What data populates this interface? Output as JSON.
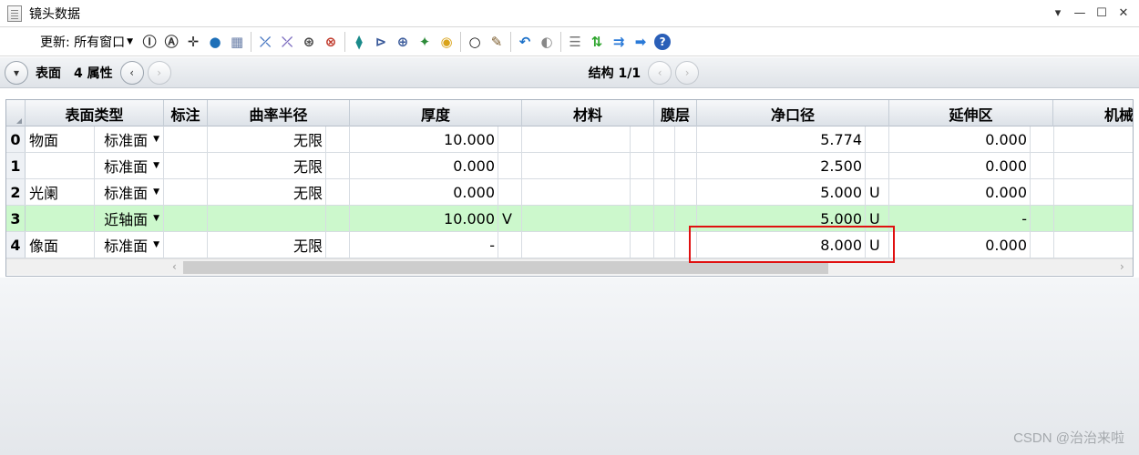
{
  "window": {
    "title": "镜头数据",
    "controls": [
      "▾",
      "—",
      "☐",
      "✕"
    ]
  },
  "toolbar": {
    "update_label": "更新: 所有窗口",
    "icons": [
      {
        "name": "refresh-icon",
        "glyph": "Ⓘ",
        "color": "#333"
      },
      {
        "name": "auto-update-icon",
        "glyph": "Ⓐ",
        "color": "#333"
      },
      {
        "name": "crosshair-icon",
        "glyph": "✛",
        "color": "#222"
      },
      {
        "name": "globe-icon",
        "glyph": "●",
        "color": "#1d6fb8"
      },
      {
        "name": "image-icon",
        "glyph": "▦",
        "color": "#6a7fa8"
      },
      {
        "name": "sep",
        "glyph": "",
        "color": ""
      },
      {
        "name": "insert-surface-icon",
        "glyph": "⤫",
        "color": "#4a78c2"
      },
      {
        "name": "delete-surface-icon",
        "glyph": "⤫",
        "color": "#7b6bbf"
      },
      {
        "name": "ray-trace-icon",
        "glyph": "⊛",
        "color": "#444"
      },
      {
        "name": "no-ray-icon",
        "glyph": "⊗",
        "color": "#c0392b"
      },
      {
        "name": "sep",
        "glyph": "",
        "color": ""
      },
      {
        "name": "lens-element-icon",
        "glyph": "⧫",
        "color": "#1a8a8a"
      },
      {
        "name": "lens-flip-icon",
        "glyph": "⊳",
        "color": "#3a5a9a"
      },
      {
        "name": "lens-split-icon",
        "glyph": "⊕",
        "color": "#3a5a9a"
      },
      {
        "name": "coordinate-icon",
        "glyph": "✦",
        "color": "#2e8b3a"
      },
      {
        "name": "palette-icon",
        "glyph": "◉",
        "color": "#d9a31a"
      },
      {
        "name": "sep",
        "glyph": "",
        "color": ""
      },
      {
        "name": "ring-icon",
        "glyph": "○",
        "color": "#111"
      },
      {
        "name": "pen-icon",
        "glyph": "✎",
        "color": "#7a5a2a"
      },
      {
        "name": "sep",
        "glyph": "",
        "color": ""
      },
      {
        "name": "undo-icon",
        "glyph": "↶",
        "color": "#1a6fc8"
      },
      {
        "name": "toggle-icon",
        "glyph": "◐",
        "color": "#888"
      },
      {
        "name": "sep",
        "glyph": "",
        "color": ""
      },
      {
        "name": "list-icon",
        "glyph": "☰",
        "color": "#777"
      },
      {
        "name": "swap-icon",
        "glyph": "⇅",
        "color": "#2aa32a"
      },
      {
        "name": "arrows-right-icon",
        "glyph": "⇉",
        "color": "#2a7ad8"
      },
      {
        "name": "arrow-right-icon",
        "glyph": "➡",
        "color": "#2a7ad8"
      },
      {
        "name": "help-icon",
        "glyph": "?",
        "color": "#ffffff"
      }
    ]
  },
  "nav": {
    "surface_label": "表面",
    "properties_label": "4 属性",
    "structure_label": "结构 1/1"
  },
  "columns": [
    "表面类型",
    "标注",
    "曲率半径",
    "厚度",
    "材料",
    "膜层",
    "净口径",
    "延伸区",
    "机械"
  ],
  "rows": [
    {
      "num": "0",
      "name": "物面",
      "type": "标准面",
      "radius": "无限",
      "thickness": "10.000",
      "thick_solve": "",
      "clear": "5.774",
      "clear_solve": "",
      "ext": "0.000",
      "highlight": false
    },
    {
      "num": "1",
      "name": "",
      "type": "标准面",
      "radius": "无限",
      "thickness": "0.000",
      "thick_solve": "",
      "clear": "2.500",
      "clear_solve": "",
      "ext": "0.000",
      "highlight": false
    },
    {
      "num": "2",
      "name": "光阑",
      "type": "标准面",
      "radius": "无限",
      "thickness": "0.000",
      "thick_solve": "",
      "clear": "5.000",
      "clear_solve": "U",
      "ext": "0.000",
      "highlight": false
    },
    {
      "num": "3",
      "name": "",
      "type": "近轴面",
      "radius": "",
      "thickness": "10.000",
      "thick_solve": "V",
      "clear": "5.000",
      "clear_solve": "U",
      "ext": "-",
      "highlight": true
    },
    {
      "num": "4",
      "name": "像面",
      "type": "标准面",
      "radius": "无限",
      "thickness": "-",
      "thick_solve": "",
      "clear": "8.000",
      "clear_solve": "U",
      "ext": "0.000",
      "highlight": false
    }
  ],
  "colors": {
    "highlight_row": "#ccf8cc",
    "annotation_box": "#e01010"
  },
  "watermark": "CSDN @治治来啦"
}
